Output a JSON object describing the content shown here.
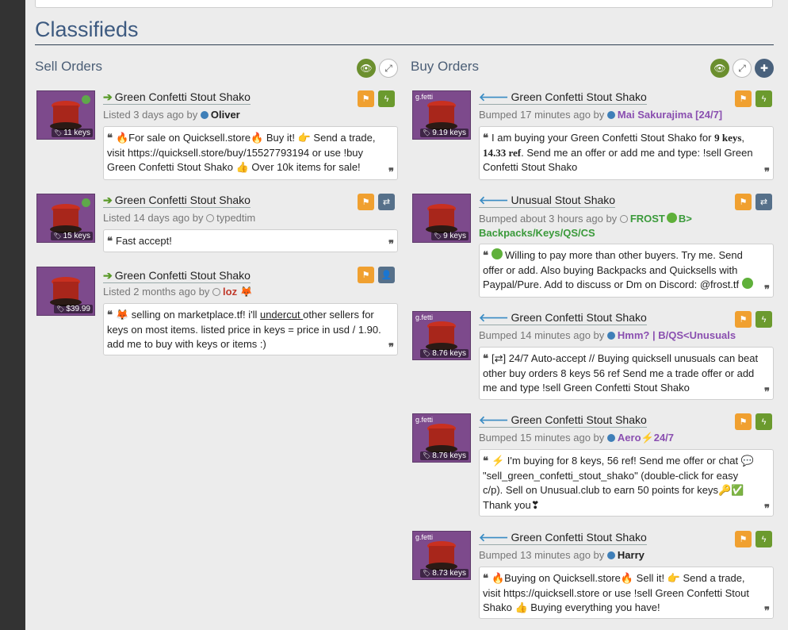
{
  "title": "Classifieds",
  "sell": {
    "heading": "Sell Orders",
    "listings": [
      {
        "name": "Green Confetti Stout Shako",
        "meta": "Listed 3 days ago by",
        "user": "Oliver",
        "price": "11 keys",
        "desc_pre": "",
        "desc": "🔥For sale on Quicksell.store🔥 Buy it! 👉 Send a trade, visit https://quicksell.store/buy/15527793194 or use !buy Green Confetti Stout Shako 👍 Over 10k items for sale!"
      },
      {
        "name": "Green Confetti Stout Shako",
        "meta": "Listed 14 days ago by",
        "user": "typedtim",
        "price": "15 keys",
        "desc": "Fast accept!"
      },
      {
        "name": "Green Confetti Stout Shako",
        "meta": "Listed 2 months ago by",
        "user": "loz",
        "user_emoji": "🦊",
        "price": "$39.99",
        "desc_a": "🦊 selling on marketplace.tf! i'll ",
        "desc_u": "undercut ",
        "desc_b": "other sellers for keys on most items. listed price in keys = price in usd / 1.90. add me to buy with keys or items :)"
      }
    ]
  },
  "buy": {
    "heading": "Buy Orders",
    "listings": [
      {
        "name": "Green Confetti Stout Shako",
        "meta": "Bumped 17 minutes ago by",
        "user": "Mai Sakurajima [24/7]",
        "label": "g.fetti",
        "price": "9.19 keys",
        "desc_a": "I am buying your Green Confetti Stout Shako for ",
        "desc_b1": "9 keys",
        "desc_c": ", ",
        "desc_b2": "14.33 ref",
        "desc_d": ". Send me an offer or add me and type: !sell Green Confetti Stout Shako"
      },
      {
        "name": "Unusual Stout Shako",
        "meta": "Bumped about 3 hours ago by",
        "user": "FROST",
        "user2": "B>",
        "user3": "Backpacks/Keys/QS/CS",
        "price": "9 keys",
        "desc": "Willing to pay more than other buyers. Try me. Send offer or add. Also buying Backpacks and Quicksells with Paypal/Pure. Add to discuss or Dm on Discord: @frost.tf"
      },
      {
        "name": "Green Confetti Stout Shako",
        "meta": "Bumped 14 minutes ago by",
        "user": "Hmm? | B/QS<Unusuals",
        "label": "g.fetti",
        "price": "8.76 keys",
        "desc": "[⇄] 24/7 Auto-accept // Buying quicksell unusuals can beat other buy orders 8 keys 56 ref Send me a trade offer or add me and type !sell Green Confetti Stout Shako"
      },
      {
        "name": "Green Confetti Stout Shako",
        "meta": "Bumped 15 minutes ago by",
        "user": "Aero",
        "user2": "24/7",
        "label": "g.fetti",
        "price": "8.76 keys",
        "desc": "⚡ I'm buying for 8 keys, 56 ref! Send me offer or chat 💬 \"sell_green_confetti_stout_shako\" (double-click for easy c/p). Sell on Unusual.club to earn 50 points for keys🔑✅ Thank you❣"
      },
      {
        "name": "Green Confetti Stout Shako",
        "meta": "Bumped 13 minutes ago by",
        "user": "Harry",
        "label": "g.fetti",
        "price": "8.73 keys",
        "desc": "🔥Buying on Quicksell.store🔥 Sell it! 👉 Send a trade, visit https://quicksell.store or use !sell Green Confetti Stout Shako 👍 Buying everything you have!"
      }
    ]
  },
  "colors": {
    "accent": "#3d5a80",
    "sell_arrow": "#5a9a2a",
    "buy_arrow": "#3a8cc4",
    "flag": "#f0a030",
    "trade": "#6b9a2e",
    "thumb": "#7d4a8c",
    "purple_user": "#8a4fb0",
    "green_user": "#3a9a3a"
  }
}
